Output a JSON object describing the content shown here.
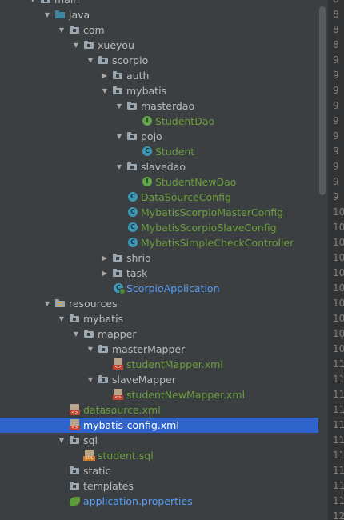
{
  "tree": [
    {
      "label": "main",
      "depth": 0,
      "arrow": "down",
      "icon": "folder",
      "label_color": "default"
    },
    {
      "label": "java",
      "depth": 1,
      "arrow": "down",
      "icon": "source-folder",
      "label_color": "default"
    },
    {
      "label": "com",
      "depth": 2,
      "arrow": "down",
      "icon": "package",
      "label_color": "default"
    },
    {
      "label": "xueyou",
      "depth": 3,
      "arrow": "down",
      "icon": "package",
      "label_color": "default"
    },
    {
      "label": "scorpio",
      "depth": 4,
      "arrow": "down",
      "icon": "package",
      "label_color": "default"
    },
    {
      "label": "auth",
      "depth": 5,
      "arrow": "right",
      "icon": "package",
      "label_color": "default"
    },
    {
      "label": "mybatis",
      "depth": 5,
      "arrow": "down",
      "icon": "package",
      "label_color": "default"
    },
    {
      "label": "masterdao",
      "depth": 6,
      "arrow": "down",
      "icon": "package",
      "label_color": "default"
    },
    {
      "label": "StudentDao",
      "depth": 7,
      "arrow": "none",
      "icon": "interface",
      "label_color": "green"
    },
    {
      "label": "pojo",
      "depth": 6,
      "arrow": "down",
      "icon": "package",
      "label_color": "default"
    },
    {
      "label": "Student",
      "depth": 7,
      "arrow": "none",
      "icon": "class",
      "label_color": "green"
    },
    {
      "label": "slavedao",
      "depth": 6,
      "arrow": "down",
      "icon": "package",
      "label_color": "default"
    },
    {
      "label": "StudentNewDao",
      "depth": 7,
      "arrow": "none",
      "icon": "interface",
      "label_color": "green"
    },
    {
      "label": "DataSourceConfig",
      "depth": 6,
      "arrow": "none",
      "icon": "class",
      "label_color": "green"
    },
    {
      "label": "MybatisScorpioMasterConfig",
      "depth": 6,
      "arrow": "none",
      "icon": "class",
      "label_color": "green"
    },
    {
      "label": "MybatisScorpioSlaveConfig",
      "depth": 6,
      "arrow": "none",
      "icon": "class",
      "label_color": "green"
    },
    {
      "label": "MybatisSimpleCheckController",
      "depth": 6,
      "arrow": "none",
      "icon": "class",
      "label_color": "green"
    },
    {
      "label": "shrio",
      "depth": 5,
      "arrow": "right",
      "icon": "package",
      "label_color": "default"
    },
    {
      "label": "task",
      "depth": 5,
      "arrow": "right",
      "icon": "package",
      "label_color": "default"
    },
    {
      "label": "ScorpioApplication",
      "depth": 5,
      "arrow": "none",
      "icon": "spring-app",
      "label_color": "blue"
    },
    {
      "label": "resources",
      "depth": 1,
      "arrow": "down",
      "icon": "resources-folder",
      "label_color": "default"
    },
    {
      "label": "mybatis",
      "depth": 2,
      "arrow": "down",
      "icon": "folder",
      "label_color": "default"
    },
    {
      "label": "mapper",
      "depth": 3,
      "arrow": "down",
      "icon": "folder",
      "label_color": "default"
    },
    {
      "label": "masterMapper",
      "depth": 4,
      "arrow": "down",
      "icon": "folder",
      "label_color": "default"
    },
    {
      "label": "studentMapper.xml",
      "depth": 5,
      "arrow": "none",
      "icon": "xml-file",
      "label_color": "green"
    },
    {
      "label": "slaveMapper",
      "depth": 4,
      "arrow": "down",
      "icon": "folder",
      "label_color": "default"
    },
    {
      "label": "studentNewMapper.xml",
      "depth": 5,
      "arrow": "none",
      "icon": "xml-file",
      "label_color": "green"
    },
    {
      "label": "datasource.xml",
      "depth": 2,
      "arrow": "none",
      "icon": "xml-file",
      "label_color": "green"
    },
    {
      "label": "mybatis-config.xml",
      "depth": 2,
      "arrow": "none",
      "icon": "xml-file",
      "label_color": "default",
      "selected": true
    },
    {
      "label": "sql",
      "depth": 2,
      "arrow": "down",
      "icon": "folder",
      "label_color": "default"
    },
    {
      "label": "student.sql",
      "depth": 3,
      "arrow": "none",
      "icon": "sql-file",
      "label_color": "green"
    },
    {
      "label": "static",
      "depth": 2,
      "arrow": "none",
      "icon": "folder",
      "label_color": "default"
    },
    {
      "label": "templates",
      "depth": 2,
      "arrow": "none",
      "icon": "folder",
      "label_color": "default"
    },
    {
      "label": "application.properties",
      "depth": 2,
      "arrow": "none",
      "icon": "properties-file",
      "label_color": "blue"
    }
  ],
  "gutter_lines": [
    "8",
    "8",
    "8",
    "8",
    "9",
    "9",
    "9",
    "9",
    "9",
    "9",
    "9",
    "9",
    "9",
    "9",
    "10",
    "10",
    "10",
    "10",
    "10",
    "10",
    "10",
    "10",
    "10",
    "10",
    "11",
    "11",
    "11",
    "11",
    "11",
    "11",
    "11",
    "11",
    "11",
    "11",
    "12"
  ],
  "colors": {
    "background": "#3c3f41",
    "selection": "#2f65ca",
    "text": "#bbbbbb",
    "label_green": "#6a9e3c",
    "label_blue": "#589df6"
  }
}
